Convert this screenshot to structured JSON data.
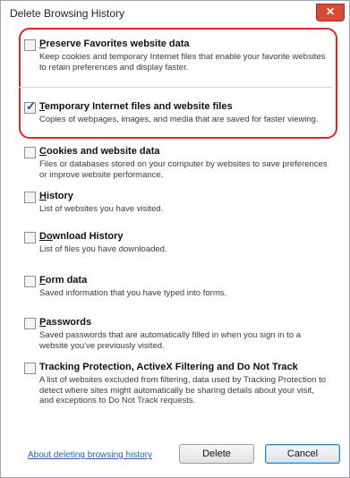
{
  "window": {
    "title": "Delete Browsing History",
    "close_label": "✕"
  },
  "options": [
    {
      "id": "preserve-favorites",
      "title_first": "P",
      "title_rest": "reserve Favorites website data",
      "checked": false,
      "description": "Keep cookies and temporary Internet files that enable your favorite websites to retain preferences and display faster."
    },
    {
      "id": "temporary-internet-files",
      "title_first": "T",
      "title_rest": "emporary Internet files and website files",
      "checked": true,
      "description": "Copies of webpages, images, and media that are saved for faster viewing."
    },
    {
      "id": "cookies",
      "title_first": "C",
      "title_rest": "ookies and website data",
      "checked": false,
      "description": "Files or databases stored on your computer by websites to save preferences or improve website performance."
    },
    {
      "id": "history",
      "title_first": "H",
      "title_rest": "istory",
      "checked": false,
      "description": "List of websites you have visited."
    },
    {
      "id": "download-history",
      "title_first": "Do",
      "title_rest": "wnload History",
      "checked": false,
      "description": "List of files you have downloaded."
    },
    {
      "id": "form-data",
      "title_first": "F",
      "title_rest": "orm data",
      "checked": false,
      "description": "Saved information that you have typed into forms."
    },
    {
      "id": "passwords",
      "title_first": "P",
      "title_rest": "asswords",
      "checked": false,
      "description": "Saved passwords that are automatically filled in when you sign in to a website you've previously visited."
    },
    {
      "id": "tracking-protection",
      "title_first": "",
      "title_rest": "Tracking Protection, ActiveX Filtering and Do Not Track",
      "checked": false,
      "description": "A list of websites excluded from filtering, data used by Tracking Protection to detect where sites might automatically be sharing details about your visit, and exceptions to Do Not Track requests."
    }
  ],
  "footer": {
    "about_link": "About deleting browsing history",
    "delete_label": "Delete",
    "cancel_label": "Cancel"
  }
}
